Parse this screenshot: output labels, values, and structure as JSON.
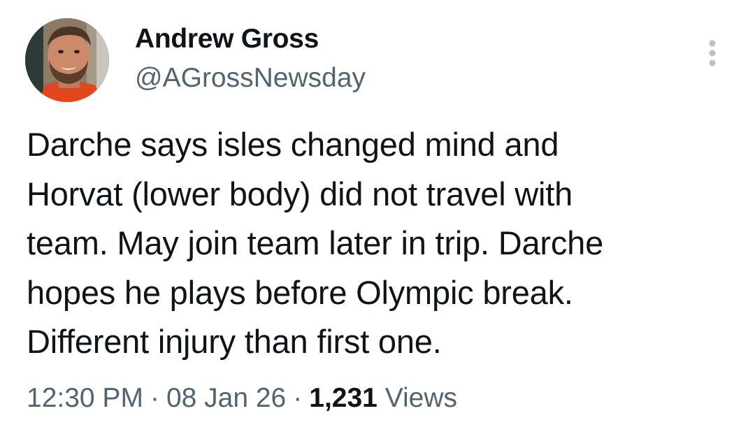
{
  "author": {
    "display_name": "Andrew Gross",
    "handle": "@AGrossNewsday"
  },
  "tweet": {
    "text": "Darche says isles changed mind and\nHorvat (lower body) did not travel with\nteam. May join team later in trip. Darche\nhopes he plays before Olympic break.\nDifferent injury than first one."
  },
  "meta": {
    "time": "12:30 PM",
    "separator": "·",
    "date": "08 Jan 26",
    "views_count": "1,231",
    "views_label": "Views"
  },
  "icons": {
    "more": "more-vertical-icon"
  },
  "colors": {
    "primary_text": "#0f1419",
    "secondary_text": "#536471",
    "background": "#ffffff",
    "more_icon": "#b9c0c6"
  }
}
